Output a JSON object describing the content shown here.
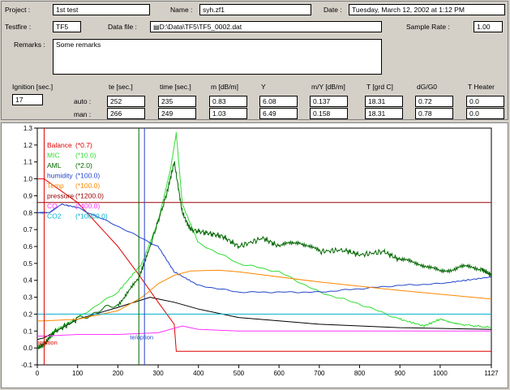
{
  "header": {
    "project_label": "Project :",
    "project_value": "1st test",
    "name_label": "Name :",
    "name_value": "syh.zf1",
    "date_label": "Date :",
    "date_value": "Tuesday, March 12, 2002 at 1:12 PM",
    "testfire_label": "Testfire :",
    "testfire_value": "TF5",
    "datafile_label": "Data file :",
    "datafile_value": "D:\\Data\\TF5\\TF5_0002.dat",
    "samplerate_label": "Sample Rate :",
    "samplerate_value": "1.00",
    "remarks_label": "Remarks :",
    "remarks_value": "Some remarks"
  },
  "results": {
    "ignition_label": "Ignition [sec.]",
    "ignition_value": "17",
    "auto_label": "auto :",
    "man_label": "man :",
    "columns": [
      {
        "header": "te [sec.]",
        "auto": "252",
        "man": "266"
      },
      {
        "header": "time [sec.]",
        "auto": "235",
        "man": "249"
      },
      {
        "header": "m [dB/m]",
        "auto": "0.83",
        "man": "1.03"
      },
      {
        "header": "Y",
        "auto": "6.08",
        "man": "6.49"
      },
      {
        "header": "m/Y [dB/m]",
        "auto": "0.137",
        "man": "0.158"
      },
      {
        "header": "T [grd C]",
        "auto": "18.31",
        "man": "18.31"
      },
      {
        "header": "dG/G0",
        "auto": "0.72",
        "man": "0.78"
      },
      {
        "header": "T Heater",
        "auto": "0.0",
        "man": "0.0"
      }
    ]
  },
  "chart_data": {
    "type": "line",
    "xlim": [
      0,
      1127
    ],
    "ylim": [
      -0.1,
      1.3
    ],
    "xticks": [
      "0",
      "100",
      "200",
      "300",
      "400",
      "500",
      "600",
      "700",
      "800",
      "900",
      "1000",
      "1127"
    ],
    "yticks": [
      "-0.1",
      "0.0",
      "0.1",
      "0.2",
      "0.3",
      "0.4",
      "0.5",
      "0.6",
      "0.7",
      "0.8",
      "0.9",
      "1.0",
      "1.1",
      "1.2",
      "1.3"
    ],
    "annotations": [
      "ignition",
      "te/option"
    ],
    "series": [
      {
        "name": "Balance",
        "factor": "(*0.7)",
        "color": "#e00000",
        "x": [
          0,
          17,
          100,
          200,
          250,
          300,
          340,
          345,
          1127
        ],
        "y": [
          1.0,
          1.0,
          0.86,
          0.6,
          0.44,
          0.27,
          0.14,
          -0.02,
          -0.02
        ]
      },
      {
        "name": "MIC",
        "factor": "(*10.0)",
        "color": "#33dd33",
        "x": [
          0,
          17,
          40,
          100,
          200,
          260,
          300,
          330,
          345,
          360,
          400,
          500,
          600,
          700,
          800,
          900,
          960,
          1000,
          1050,
          1127
        ],
        "y": [
          0.0,
          0.02,
          0.1,
          0.18,
          0.33,
          0.5,
          0.75,
          1.05,
          1.27,
          0.85,
          0.62,
          0.5,
          0.45,
          0.33,
          0.26,
          0.17,
          0.13,
          0.17,
          0.14,
          0.12
        ]
      },
      {
        "name": "AML",
        "factor": "(*2.0)",
        "color": "#006600",
        "x": [
          0,
          17,
          40,
          100,
          200,
          250,
          280,
          320,
          340,
          360,
          380,
          420,
          460,
          500,
          560,
          600,
          650,
          700,
          760,
          800,
          860,
          900,
          950,
          1000,
          1050,
          1100,
          1127
        ],
        "y": [
          0.0,
          0.02,
          0.09,
          0.17,
          0.26,
          0.4,
          0.6,
          0.9,
          1.1,
          0.8,
          0.7,
          0.68,
          0.66,
          0.6,
          0.65,
          0.6,
          0.63,
          0.57,
          0.58,
          0.55,
          0.57,
          0.52,
          0.5,
          0.45,
          0.48,
          0.47,
          0.43
        ]
      },
      {
        "name": "humidity",
        "factor": "(*100.0)",
        "color": "#2244cc",
        "x": [
          0,
          30,
          60,
          100,
          200,
          300,
          340,
          400,
          500,
          600,
          700,
          800,
          900,
          1000,
          1127
        ],
        "y": [
          0.8,
          0.8,
          0.85,
          0.83,
          0.72,
          0.6,
          0.45,
          0.37,
          0.33,
          0.33,
          0.33,
          0.35,
          0.37,
          0.38,
          0.42
        ]
      },
      {
        "name": "Temp",
        "factor": "(*100.0)",
        "color": "#ff8800",
        "x": [
          0,
          17,
          100,
          200,
          260,
          300,
          340,
          380,
          450,
          500,
          700,
          900,
          1127
        ],
        "y": [
          0.16,
          0.16,
          0.17,
          0.22,
          0.3,
          0.38,
          0.43,
          0.455,
          0.46,
          0.45,
          0.39,
          0.34,
          0.29
        ]
      },
      {
        "name": "pressure",
        "factor": "(*1200.0)",
        "color": "#990000",
        "x": [
          0,
          1127
        ],
        "y": [
          0.86,
          0.86
        ]
      },
      {
        "name": "CO",
        "factor": "(*400.0)",
        "color": "#ff33ff",
        "x": [
          0,
          17,
          100,
          200,
          300,
          360,
          380,
          400,
          500,
          700,
          900,
          1127
        ],
        "y": [
          0.07,
          0.07,
          0.08,
          0.08,
          0.09,
          0.13,
          0.12,
          0.11,
          0.1,
          0.1,
          0.1,
          0.1
        ]
      },
      {
        "name": "CO2",
        "factor": "(*10000.0)",
        "color": "#00b0d0",
        "x": [
          0,
          1127
        ],
        "y": [
          0.2,
          0.2
        ]
      }
    ],
    "extra_lines": [
      {
        "label": "black",
        "color": "#000000",
        "x": [
          0,
          17,
          100,
          200,
          280,
          300,
          340,
          400,
          500,
          700,
          900,
          1127
        ],
        "y": [
          0.05,
          0.06,
          0.17,
          0.24,
          0.3,
          0.29,
          0.27,
          0.23,
          0.18,
          0.14,
          0.12,
          0.11
        ]
      }
    ],
    "vlines": [
      {
        "x": 17,
        "color": "#e00000"
      },
      {
        "x": 252,
        "color": "#006600"
      },
      {
        "x": 266,
        "color": "#2244cc"
      }
    ]
  }
}
